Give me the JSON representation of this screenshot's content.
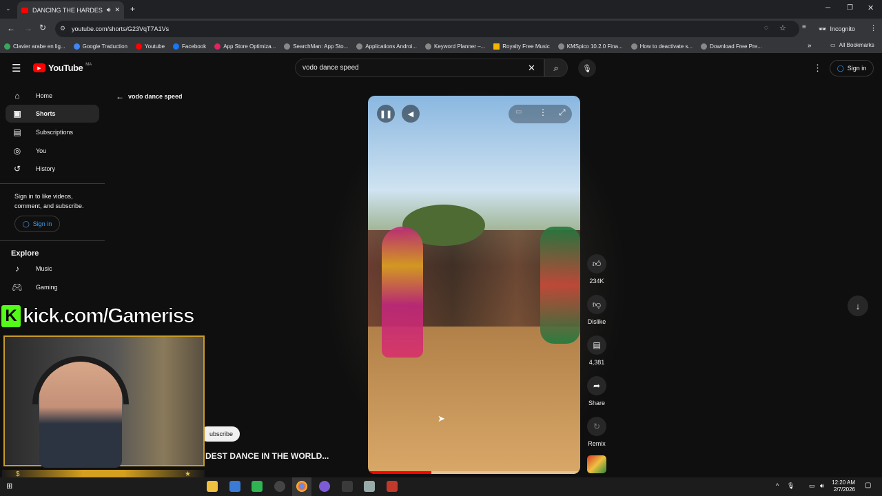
{
  "browser": {
    "tab_title": "DANCING THE HARDEST D",
    "url": "youtube.com/shorts/G23VqT7A1Vs",
    "incognito_label": "Incognito",
    "bookmarks": [
      "Clavier arabe en lig...",
      "Google Traduction",
      "Youtube",
      "Facebook",
      "App Store Optimiza...",
      "SearchMan: App Sto...",
      "Applications Androi...",
      "Keyword Planner –...",
      "Royalty Free Music",
      "KMSpico 10.2.0 Fina...",
      "How to deactivate s...",
      "Download Free Pre..."
    ],
    "all_bookmarks": "All Bookmarks"
  },
  "youtube": {
    "logo_text": "YouTube",
    "region": "MA",
    "search_value": "vodo dance speed",
    "sign_in": "Sign in",
    "back_label": "vodo dance speed"
  },
  "sidebar": {
    "items": [
      {
        "label": "Home",
        "icon": "home-icon"
      },
      {
        "label": "Shorts",
        "icon": "shorts-icon"
      },
      {
        "label": "Subscriptions",
        "icon": "subscriptions-icon"
      },
      {
        "label": "You",
        "icon": "you-icon"
      },
      {
        "label": "History",
        "icon": "history-icon"
      }
    ],
    "sign_in_prompt": "Sign in to like videos, comment, and subscribe.",
    "sign_in_button": "Sign in",
    "explore_heading": "Explore",
    "explore_items": [
      {
        "label": "Music",
        "icon": "music-icon"
      },
      {
        "label": "Gaming",
        "icon": "gaming-icon"
      }
    ]
  },
  "overlay": {
    "kick_text": "kick.com/Gameriss"
  },
  "short": {
    "title_visible": "DEST DANCE IN THE WORLD...",
    "subscribe_visible": "ubscribe",
    "progress": 0.3,
    "actions": {
      "likes": "234K",
      "dislike": "Dislike",
      "comments": "4,381",
      "share": "Share",
      "remix": "Remix"
    }
  },
  "taskbar": {
    "time": "12:20 AM",
    "date": "2/7/2026"
  }
}
